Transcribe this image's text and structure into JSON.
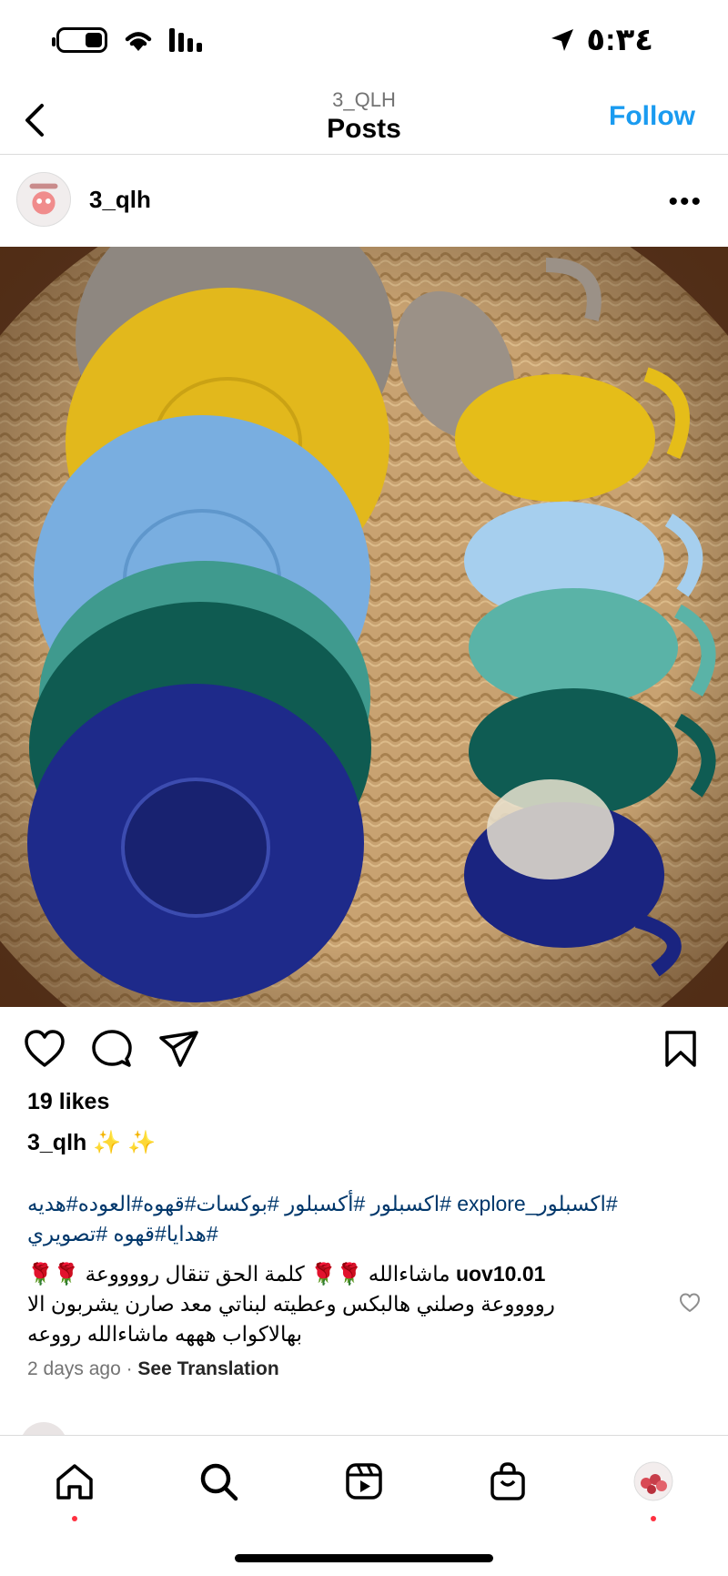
{
  "status": {
    "time": "٥:٣٤",
    "icons": [
      "location-arrow-icon",
      "signal-icon",
      "wifi-icon",
      "battery-icon"
    ]
  },
  "header": {
    "subtitle": "3_QLH",
    "title": "Posts",
    "follow_label": "Follow"
  },
  "post": {
    "username": "3_qlh",
    "more_label": "•••",
    "likes": "19 likes",
    "caption_user": "3_qlh",
    "caption_text": " ✨ ✨",
    "hashtags": "#اكسبلور_explore #اكسبلور #أكسبلور #بوكسات#قهوه#العوده#هديه #هدايا#قهوه #تصويري",
    "comment": {
      "user": "uov10.01",
      "text": "ماشاءالله 🌹🌹 كلمة الحق تنقال رووووعة 🌹🌹 رووووعة وصلني هالبكس وعطيته لبناتي معد صارن يشربون الا بهالاكواب هههه ماشاءالله رووعه"
    },
    "time_ago": "2 days ago",
    "see_translation": "See Translation"
  },
  "colors": {
    "follow": "#1a9bf0",
    "hashtag": "#00376b",
    "notification_dot": "#ff3040"
  },
  "nav_tabs": [
    "home-icon",
    "search-icon",
    "reels-icon",
    "shop-icon",
    "profile-avatar"
  ]
}
